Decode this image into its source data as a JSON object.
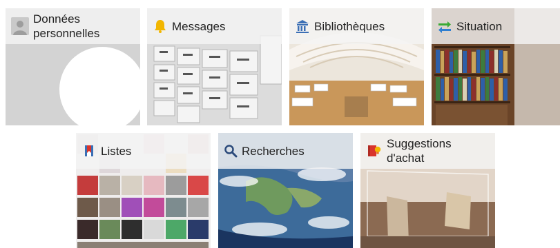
{
  "tiles": {
    "donnees": {
      "label": "Données personnelles",
      "icon": "user-avatar-icon"
    },
    "messages": {
      "label": "Messages",
      "icon": "bell-icon"
    },
    "bibliotheques": {
      "label": "Bibliothèques",
      "icon": "library-icon"
    },
    "situation": {
      "label": "Situation",
      "icon": "swap-arrows-icon"
    },
    "listes": {
      "label": "Listes",
      "icon": "bookmark-list-icon"
    },
    "recherches": {
      "label": "Recherches",
      "icon": "search-icon"
    },
    "suggestions": {
      "label": "Suggestions d'achat",
      "icon": "book-suggestion-icon"
    }
  },
  "colors": {
    "band": "#f4f4f4",
    "label": "#222222",
    "bell": "#f2b600",
    "library": "#3b6fb5",
    "swap_green": "#3aaa35",
    "swap_blue": "#2f7fd1",
    "list_red": "#d9342b",
    "suggest_orange": "#e8772a"
  }
}
